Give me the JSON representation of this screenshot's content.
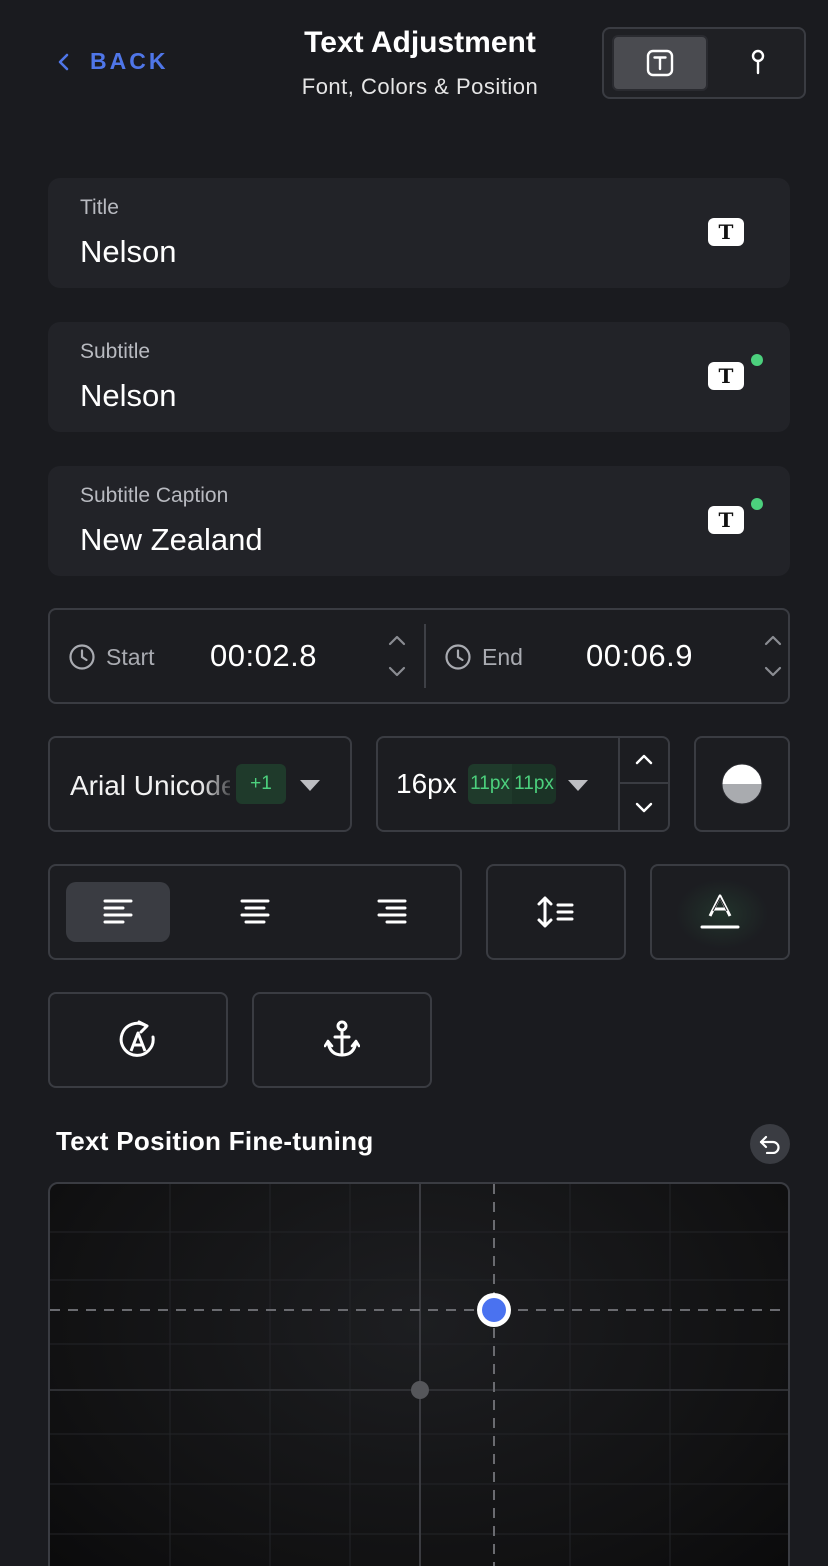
{
  "header": {
    "back_label": "BACK",
    "title": "Text Adjustment",
    "subtitle": "Font, Colors & Position",
    "modes": [
      {
        "name": "text-mode",
        "icon": "text-box-icon",
        "active": true
      },
      {
        "name": "pin-mode",
        "icon": "pin-icon",
        "active": false
      }
    ]
  },
  "fields": [
    {
      "label": "Title",
      "value": "Nelson",
      "badge": "T",
      "modified": false
    },
    {
      "label": "Subtitle",
      "value": "Nelson",
      "badge": "T",
      "modified": true
    },
    {
      "label": "Subtitle Caption",
      "value": "New Zealand",
      "badge": "T",
      "modified": true
    }
  ],
  "timing": {
    "start_label": "Start",
    "start_value": "00:02.8",
    "end_label": "End",
    "end_value": "00:06.9"
  },
  "font": {
    "family": "Arial Unicode",
    "extra_count": "+1",
    "size": "16px",
    "size_badges": [
      "11px",
      "11px"
    ]
  },
  "text_position": {
    "title": "Text Position Fine-tuning"
  },
  "colors": {
    "background": "#1a1b1f",
    "card": "#222328",
    "accent_blue": "#4f76e8",
    "status_green": "#4cd07d",
    "border": "#3a3c42"
  }
}
